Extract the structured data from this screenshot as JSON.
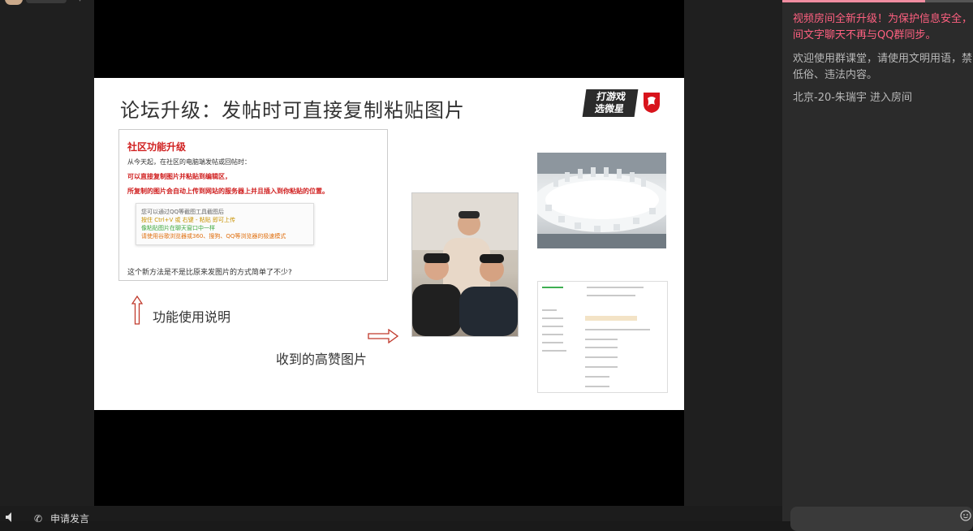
{
  "slide": {
    "title": "论坛升级：发帖时可直接复制粘贴图片",
    "logo_text_line1": "打游戏",
    "logo_text_line2": "选微星",
    "panel": {
      "heading": "社区功能升级",
      "line1": "从今天起，在社区的电脑端发帖或回帖时：",
      "line2": "可以直接复制图片并粘贴到编辑区，",
      "line3": "所复制的图片会自动上传到网站的服务器上并且插入到你粘贴的位置。",
      "tip1": "您可以通过QQ等截图工具截图后",
      "tip2": "按住 Ctrl+V 或 右键 - 粘贴 即可上传",
      "tip3": "像粘贴图片在聊天窗口中一样",
      "tip4": "请使用谷歌浏览器或360、搜狗、QQ等浏览器的极速模式",
      "footer": "这个新方法是不是比原来发图片的方式简单了不少?"
    },
    "function_label": "功能使用说明",
    "received_label": "收到的高赞图片"
  },
  "bottom_bar": {
    "apply_speak": "申请发言"
  },
  "chat": {
    "system_notice_line1": "视频房间全新升级！为保护信息安全，",
    "system_notice_line2": "间文字聊天不再与QQ群同步。",
    "welcome_line1": "欢迎使用群课堂，请使用文明用语，禁",
    "welcome_line2": "低俗、违法内容。",
    "enter_message": "北京-20-朱瑞宇 进入房间"
  },
  "icons": {
    "speaker": "speaker-icon",
    "mic": "microphone-icon",
    "emoji": "emoji-icon"
  },
  "colors": {
    "notice": "#ff6080",
    "panel_heading": "#d02020",
    "accent": "#f08ca0"
  }
}
